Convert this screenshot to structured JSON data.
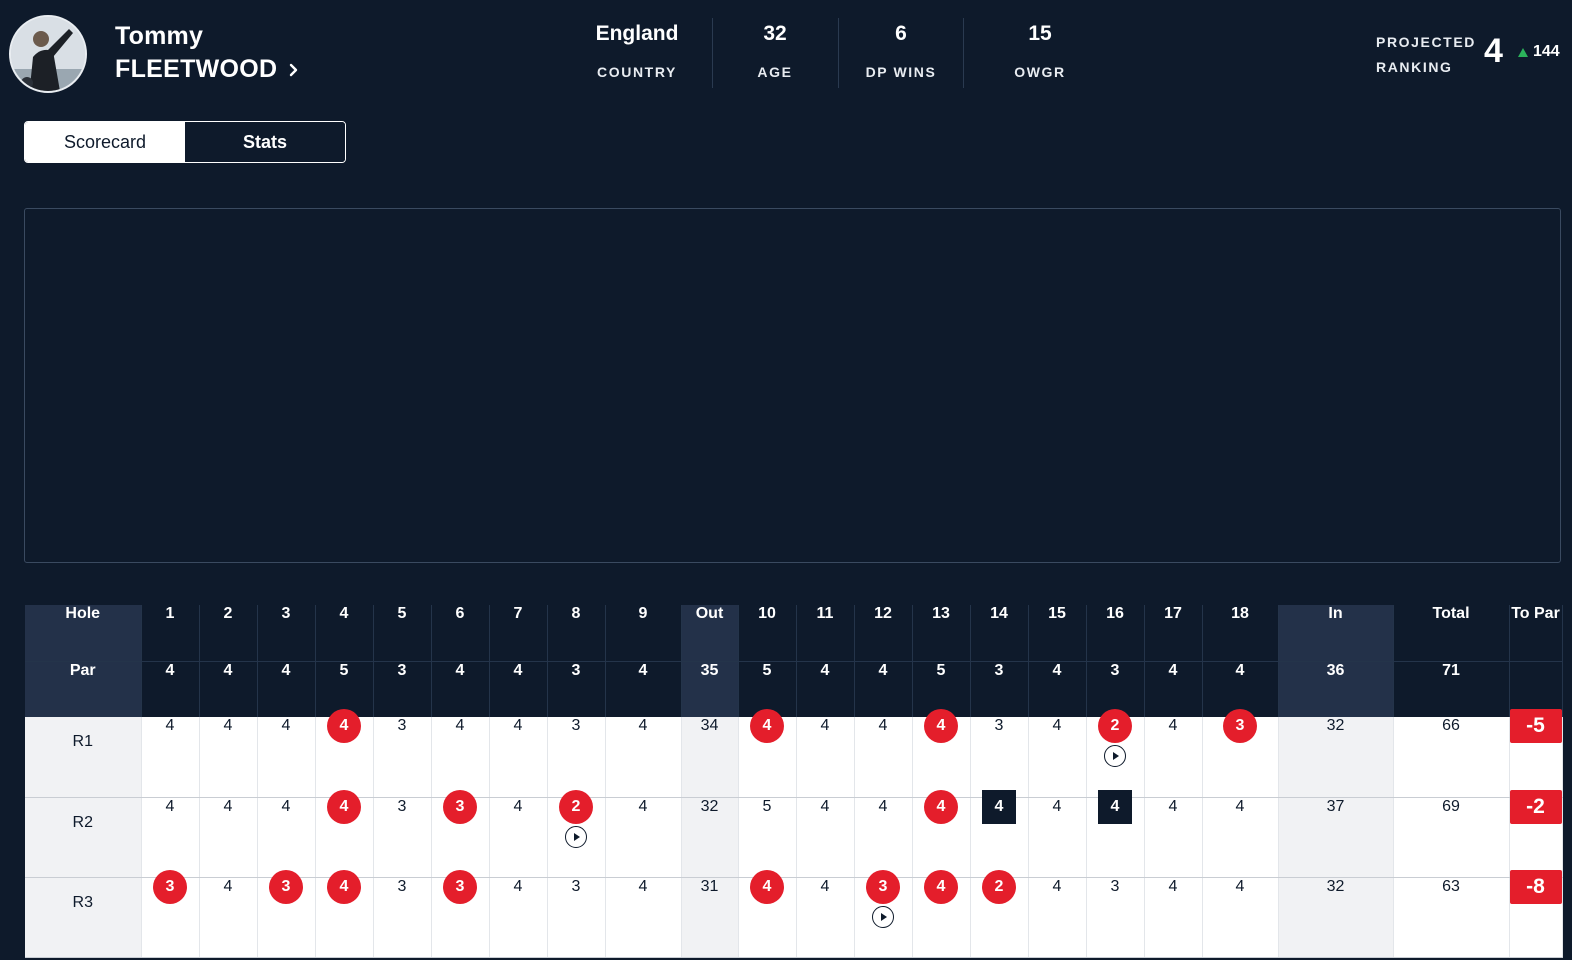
{
  "player": {
    "first_name": "Tommy",
    "last_name": "FLEETWOOD",
    "country": "England",
    "country_label": "COUNTRY",
    "age": "32",
    "age_label": "AGE",
    "dp_wins": "6",
    "dp_wins_label": "DP WINS",
    "owgr": "15",
    "owgr_label": "OWGR"
  },
  "projected": {
    "label_line1": "PROJECTED",
    "label_line2": "RANKING",
    "value": "4",
    "movement": "144",
    "movement_color": "#2bb35b"
  },
  "tabs": [
    {
      "label": "Scorecard",
      "active": true
    },
    {
      "label": "Stats",
      "active": false
    }
  ],
  "scorecard": {
    "hole_label": "Hole",
    "par_label": "Par",
    "holes": [
      "1",
      "2",
      "3",
      "4",
      "5",
      "6",
      "7",
      "8",
      "9",
      "Out",
      "10",
      "11",
      "12",
      "13",
      "14",
      "15",
      "16",
      "17",
      "18",
      "In",
      "Total",
      "To Par"
    ],
    "par": [
      "4",
      "4",
      "4",
      "5",
      "3",
      "4",
      "4",
      "3",
      "4",
      "35",
      "5",
      "4",
      "4",
      "5",
      "3",
      "4",
      "3",
      "4",
      "4",
      "36",
      "71",
      ""
    ],
    "rounds": [
      {
        "label": "R1",
        "scores": [
          "4",
          "4",
          "4",
          "4",
          "3",
          "4",
          "4",
          "3",
          "4",
          "34",
          "4",
          "4",
          "4",
          "4",
          "3",
          "4",
          "2",
          "4",
          "3",
          "32",
          "66"
        ],
        "birdies": [
          3,
          10,
          13,
          16,
          18
        ],
        "bogeys": [],
        "videos": [
          16
        ],
        "to_par": "-5"
      },
      {
        "label": "R2",
        "scores": [
          "4",
          "4",
          "4",
          "4",
          "3",
          "3",
          "4",
          "2",
          "4",
          "32",
          "5",
          "4",
          "4",
          "4",
          "4",
          "4",
          "4",
          "4",
          "4",
          "37",
          "69"
        ],
        "birdies": [
          3,
          5,
          7,
          13
        ],
        "bogeys": [
          14,
          16
        ],
        "videos": [
          7
        ],
        "to_par": "-2"
      },
      {
        "label": "R3",
        "scores": [
          "3",
          "4",
          "3",
          "4",
          "3",
          "3",
          "4",
          "3",
          "4",
          "31",
          "4",
          "4",
          "3",
          "4",
          "2",
          "4",
          "3",
          "4",
          "4",
          "32",
          "63"
        ],
        "birdies": [
          0,
          2,
          3,
          5,
          10,
          12,
          13,
          14
        ],
        "bogeys": [],
        "videos": [
          12
        ],
        "to_par": "-8"
      }
    ]
  },
  "colors": {
    "background": "#0e1a2b",
    "birdie": "#e41e2b",
    "bogey": "#0e1a2b",
    "subtotal_header": "#233149"
  }
}
